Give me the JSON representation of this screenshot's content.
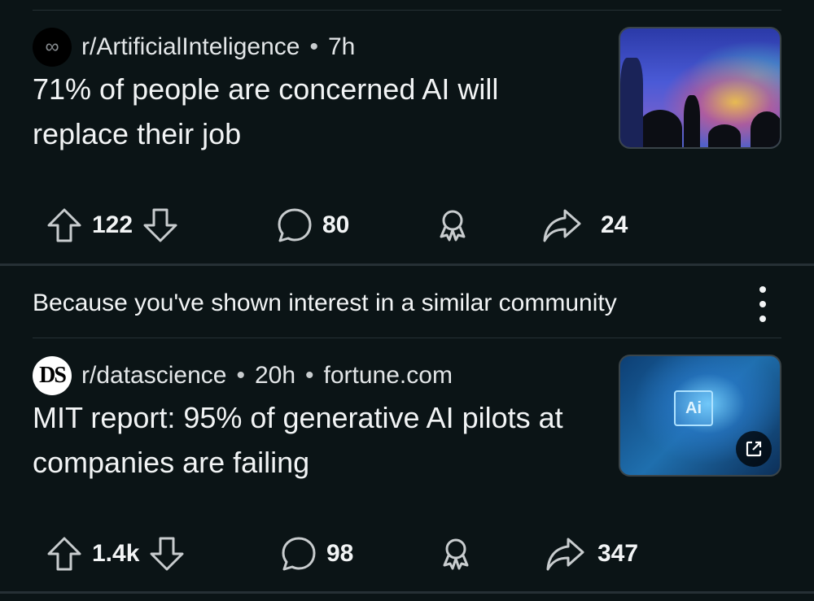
{
  "posts": [
    {
      "avatar_symbol": "∞",
      "subreddit": "r/ArtificialInteligence",
      "time": "7h",
      "title": "71% of people are concerned AI will replace their job",
      "upvotes": "122",
      "comments": "80",
      "shares": "24"
    },
    {
      "avatar_text": "DS",
      "subreddit": "r/datascience",
      "time": "20h",
      "domain": "fortune.com",
      "title": "MIT report: 95% of generative AI pilots at companies are failing",
      "thumbnail_badge": "Ai",
      "upvotes": "1.4k",
      "comments": "98",
      "shares": "347"
    }
  ],
  "recommendation": {
    "text": "Because you've shown interest in a similar community"
  },
  "theme": {
    "background": "#0b1416",
    "text": "#f2f4f5",
    "icon_stroke": "#c8ccce",
    "divider": "#263035"
  },
  "icons": {
    "upvote": "upvote-icon",
    "downvote": "downvote-icon",
    "comment": "comment-icon",
    "award": "award-icon",
    "share": "share-icon",
    "more": "more-options-icon",
    "external": "external-link-icon"
  }
}
